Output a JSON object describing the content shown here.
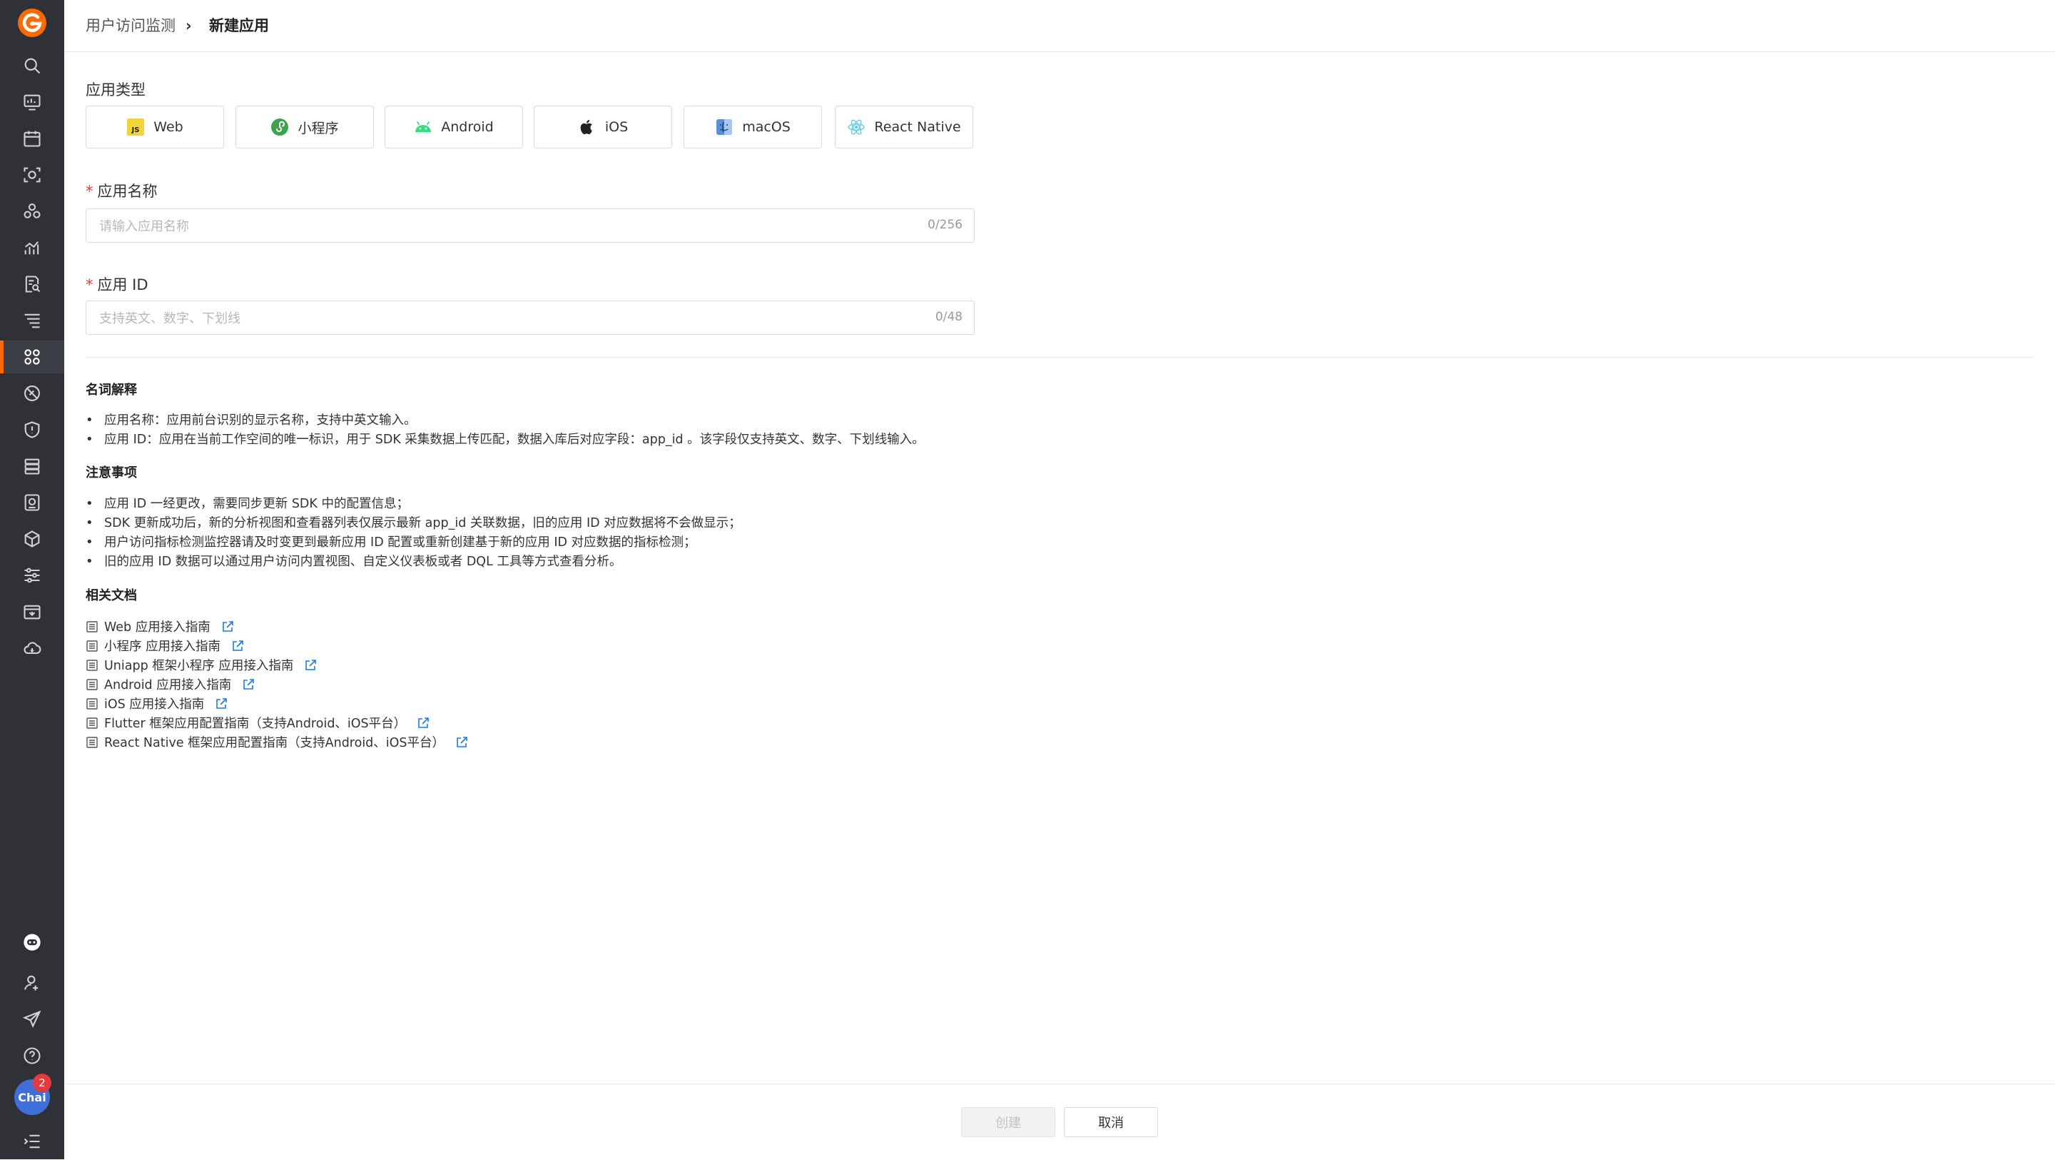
{
  "breadcrumb": {
    "parent": "用户访问监测",
    "separator": "›",
    "current": "新建应用"
  },
  "app_type": {
    "label": "应用类型",
    "options": [
      {
        "label": "Web",
        "icon": "js-icon"
      },
      {
        "label": "小程序",
        "icon": "miniprogram-icon"
      },
      {
        "label": "Android",
        "icon": "android-icon"
      },
      {
        "label": "iOS",
        "icon": "apple-icon"
      },
      {
        "label": "macOS",
        "icon": "macos-icon"
      },
      {
        "label": "React Native",
        "icon": "react-icon"
      }
    ]
  },
  "app_name": {
    "required_mark": "*",
    "label": "应用名称",
    "placeholder": "请输入应用名称",
    "value": "",
    "counter": "0/256"
  },
  "app_id": {
    "required_mark": "*",
    "label": "应用 ID",
    "placeholder": "支持英文、数字、下划线",
    "value": "",
    "counter": "0/48"
  },
  "glossary": {
    "title": "名词解释",
    "items": [
      "应用名称：应用前台识别的显示名称，支持中英文输入。",
      "应用 ID：应用在当前工作空间的唯一标识，用于 SDK 采集数据上传匹配，数据入库后对应字段：app_id 。该字段仅支持英文、数字、下划线输入。"
    ]
  },
  "notes": {
    "title": "注意事项",
    "items": [
      "应用 ID 一经更改，需要同步更新 SDK 中的配置信息；",
      "SDK 更新成功后，新的分析视图和查看器列表仅展示最新 app_id 关联数据，旧的应用 ID 对应数据将不会做显示；",
      "用户访问指标检测监控器请及时变更到最新应用 ID 配置或重新创建基于新的应用 ID 对应数据的指标检测；",
      "旧的应用 ID 数据可以通过用户访问内置视图、自定义仪表板或者 DQL 工具等方式查看分析。"
    ]
  },
  "docs": {
    "title": "相关文档",
    "items": [
      "Web 应用接入指南",
      "小程序 应用接入指南",
      "Uniapp 框架小程序 应用接入指南",
      "Android 应用接入指南",
      "iOS 应用接入指南",
      "Flutter 框架应用配置指南（支持Android、iOS平台）",
      "React Native 框架应用配置指南（支持Android、iOS平台）"
    ]
  },
  "footer": {
    "create_label": "创建",
    "cancel_label": "取消"
  },
  "user": {
    "avatar_text": "Chai",
    "badge_count": "2"
  },
  "colors": {
    "brand": "#ff6a00",
    "sidebar_bg": "#2f3137",
    "link": "#1f7ae0",
    "required": "#e5393d"
  }
}
